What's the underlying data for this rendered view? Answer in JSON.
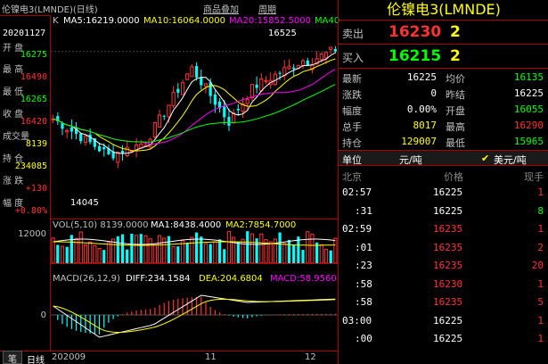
{
  "window": {
    "title": "伦镍电3(LMNDE)(日线)",
    "btn_add": "商品叠加",
    "btn_period": "周期"
  },
  "info": {
    "date": "20201127",
    "open_label": "开 盘",
    "open": "16275",
    "high_label": "最 高",
    "high": "16490",
    "low_label": "最 低",
    "low": "16265",
    "close_label": "收 盘",
    "close": "16420",
    "volume_label": "成交量",
    "volume": "8139",
    "oi_label": "持 仓",
    "oi": "234085",
    "change_label": "涨 跌",
    "change": "+130",
    "amp_label": "幅 度",
    "amp": "+0.80%"
  },
  "kline": {
    "indicator": "K",
    "ma5": "MA5:16219.0000",
    "ma10": "MA10:16064.0000",
    "ma20": "MA20:15852.5000",
    "ma40": "MA40",
    "hi_label": "16525",
    "lo_label": "14045"
  },
  "volume": {
    "header": "VOL(5,10) 8139.0000",
    "ma1": "MA1:8438.4000",
    "ma2": "MA2:7854.7000",
    "axis": "12000"
  },
  "macd": {
    "header": "MACD(26,12,9)",
    "diff": "DIFF:234.1584",
    "dea": "DEA:204.6804",
    "macd": "MACD:58.9560",
    "axis": "0"
  },
  "xaxis": {
    "period": "日线",
    "start": "202009",
    "m11": "11",
    "m12": "12"
  },
  "quote": {
    "title": "伦镍电3(LMNDE)",
    "sell_label": "卖出",
    "sell_price": "16230",
    "sell_qty": "2",
    "buy_label": "买入",
    "buy_price": "16215",
    "buy_qty": "2",
    "stats": [
      {
        "l1": "最新",
        "v1": "16225",
        "c1": "#ffffff",
        "l2": "均价",
        "v2": "16135",
        "c2": "#00ff00"
      },
      {
        "l1": "涨跌",
        "v1": "0",
        "c1": "#ffffff",
        "l2": "昨结",
        "v2": "16225",
        "c2": "#ffffff"
      },
      {
        "l1": "幅度",
        "v1": "0.00%",
        "c1": "#ffffff",
        "l2": "开盘",
        "v2": "16055",
        "c2": "#00ff00"
      },
      {
        "l1": "总手",
        "v1": "8017",
        "c1": "#ffff00",
        "l2": "最高",
        "v2": "16290",
        "c2": "#ff3333"
      },
      {
        "l1": "持仓",
        "v1": "129007",
        "c1": "#ffff00",
        "l2": "最低",
        "v2": "15965",
        "c2": "#00ff00"
      }
    ],
    "unit_label": "单位",
    "unit_value": "元/吨",
    "unit_usd": "美元/吨",
    "tick_header": {
      "place": "北京",
      "price": "价格",
      "qty": "现手"
    },
    "ticks": [
      {
        "time": "02:57",
        "price": "16225",
        "pc": "#ffffff",
        "qty": "1",
        "qc": "#ff3333"
      },
      {
        "time": ":31",
        "price": "16225",
        "pc": "#ffffff",
        "qty": "8",
        "qc": "#00ff00"
      },
      {
        "time": "02:59",
        "price": "16235",
        "pc": "#ff3333",
        "qty": "1",
        "qc": "#ff3333"
      },
      {
        "time": ":01",
        "price": "16235",
        "pc": "#ff3333",
        "qty": "2",
        "qc": "#ff3333"
      },
      {
        "time": ":23",
        "price": "16235",
        "pc": "#ff3333",
        "qty": "20",
        "qc": "#ff3333"
      },
      {
        "time": ":58",
        "price": "16230",
        "pc": "#ff3333",
        "qty": "1",
        "qc": "#ff3333"
      },
      {
        "time": ":58",
        "price": "16235",
        "pc": "#ff3333",
        "qty": "5",
        "qc": "#ff3333"
      },
      {
        "time": "03:00",
        "price": "16225",
        "pc": "#ffffff",
        "qty": "1",
        "qc": "#ff3333"
      },
      {
        "time": ":00",
        "price": "16225",
        "pc": "#ffffff",
        "qty": "1",
        "qc": "#ff3333"
      }
    ],
    "bottom_tab": "笔"
  },
  "colors": {
    "up": "#ff3333",
    "down": "#00ffff",
    "frame": "#aa0000",
    "ma5": "#ffffff",
    "ma10": "#ffff00",
    "ma20": "#ff00ff",
    "ma40": "#00ff00"
  }
}
